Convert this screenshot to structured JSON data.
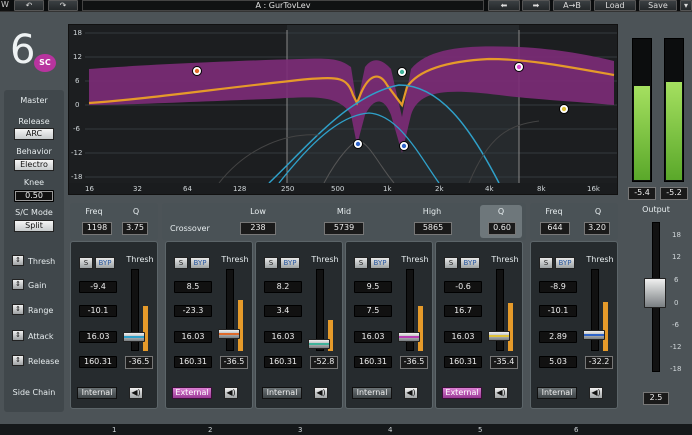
{
  "topbar": {
    "undo": "↶",
    "redo": "↷",
    "preset": "A : GurTovLev",
    "prev": "⬅",
    "next": "➡",
    "ab": "A→B",
    "load": "Load",
    "save": "Save",
    "waves": "W"
  },
  "logo": {
    "number": "6",
    "badge": "SC"
  },
  "master": {
    "title": "Master",
    "release_label": "Release",
    "release_value": "ARC",
    "behavior_label": "Behavior",
    "behavior_value": "Electro",
    "knee_label": "Knee",
    "knee_value": "0.50",
    "sc_label": "S/C Mode",
    "sc_value": "Split"
  },
  "side": {
    "thresh": "Thresh",
    "gain": "Gain",
    "range": "Range",
    "attack": "Attack",
    "release": "Release",
    "sidechain": "Side Chain"
  },
  "eq": {
    "y_ticks": [
      "18",
      "12",
      "6",
      "0",
      "-6",
      "-12",
      "-18"
    ],
    "x_ticks": [
      "16",
      "32",
      "64",
      "128",
      "250",
      "500",
      "1k",
      "2k",
      "4k",
      "8k",
      "16k"
    ]
  },
  "lowshelf": {
    "freq_label": "Freq",
    "q_label": "Q",
    "freq": "1198",
    "q": "3.75"
  },
  "crossover": {
    "label": "Crossover",
    "low_label": "Low",
    "mid_label": "Mid",
    "high_label": "High",
    "q_label": "Q",
    "low": "238",
    "mid": "5739",
    "high": "5865",
    "q": "0.60"
  },
  "highshelf": {
    "freq_label": "Freq",
    "q_label": "Q",
    "freq": "644",
    "q": "3.20"
  },
  "bands": [
    {
      "s": "S",
      "byp": "BYP",
      "thresh_label": "Thresh",
      "gain": "-9.4",
      "range": "-10.1",
      "attack": "16.03",
      "release": "160.31",
      "thresh": "-36.5",
      "sc": "Internal",
      "spk": "◀)"
    },
    {
      "s": "S",
      "byp": "BYP",
      "thresh_label": "Thresh",
      "gain": "8.5",
      "range": "-23.3",
      "attack": "16.03",
      "release": "160.31",
      "thresh": "-36.5",
      "sc": "External",
      "spk": "◀)"
    },
    {
      "s": "S",
      "byp": "BYP",
      "thresh_label": "Thresh",
      "gain": "8.2",
      "range": "3.4",
      "attack": "16.03",
      "release": "160.31",
      "thresh": "-52.8",
      "sc": "Internal",
      "spk": "◀)"
    },
    {
      "s": "S",
      "byp": "BYP",
      "thresh_label": "Thresh",
      "gain": "9.5",
      "range": "7.5",
      "attack": "16.03",
      "release": "160.31",
      "thresh": "-36.5",
      "sc": "Internal",
      "spk": "◀)"
    },
    {
      "s": "S",
      "byp": "BYP",
      "thresh_label": "Thresh",
      "gain": "-0.6",
      "range": "16.7",
      "attack": "16.03",
      "release": "160.31",
      "thresh": "-35.4",
      "sc": "External",
      "spk": "◀)"
    },
    {
      "s": "S",
      "byp": "BYP",
      "thresh_label": "Thresh",
      "gain": "-8.9",
      "range": "-10.1",
      "attack": "2.89",
      "release": "5.03",
      "thresh": "-32.2",
      "sc": "Internal",
      "spk": "◀)"
    }
  ],
  "output": {
    "meter_l": "-5.4",
    "meter_r": "-5.2",
    "label": "Output",
    "value": "2.5",
    "ticks": [
      "18",
      "12",
      "6",
      "0",
      "-6",
      "-12",
      "-18"
    ]
  },
  "bottom": {
    "labels": [
      "1",
      "2",
      "3",
      "4",
      "5",
      "6"
    ]
  },
  "colors": {
    "accent": "#d94fd0",
    "band1": "#e06a2a",
    "band2": "#e59a2a",
    "band3": "#3fb39a",
    "band4": "#6a4fe0",
    "band5": "#e0c23a",
    "meter": "#7bc63a"
  }
}
